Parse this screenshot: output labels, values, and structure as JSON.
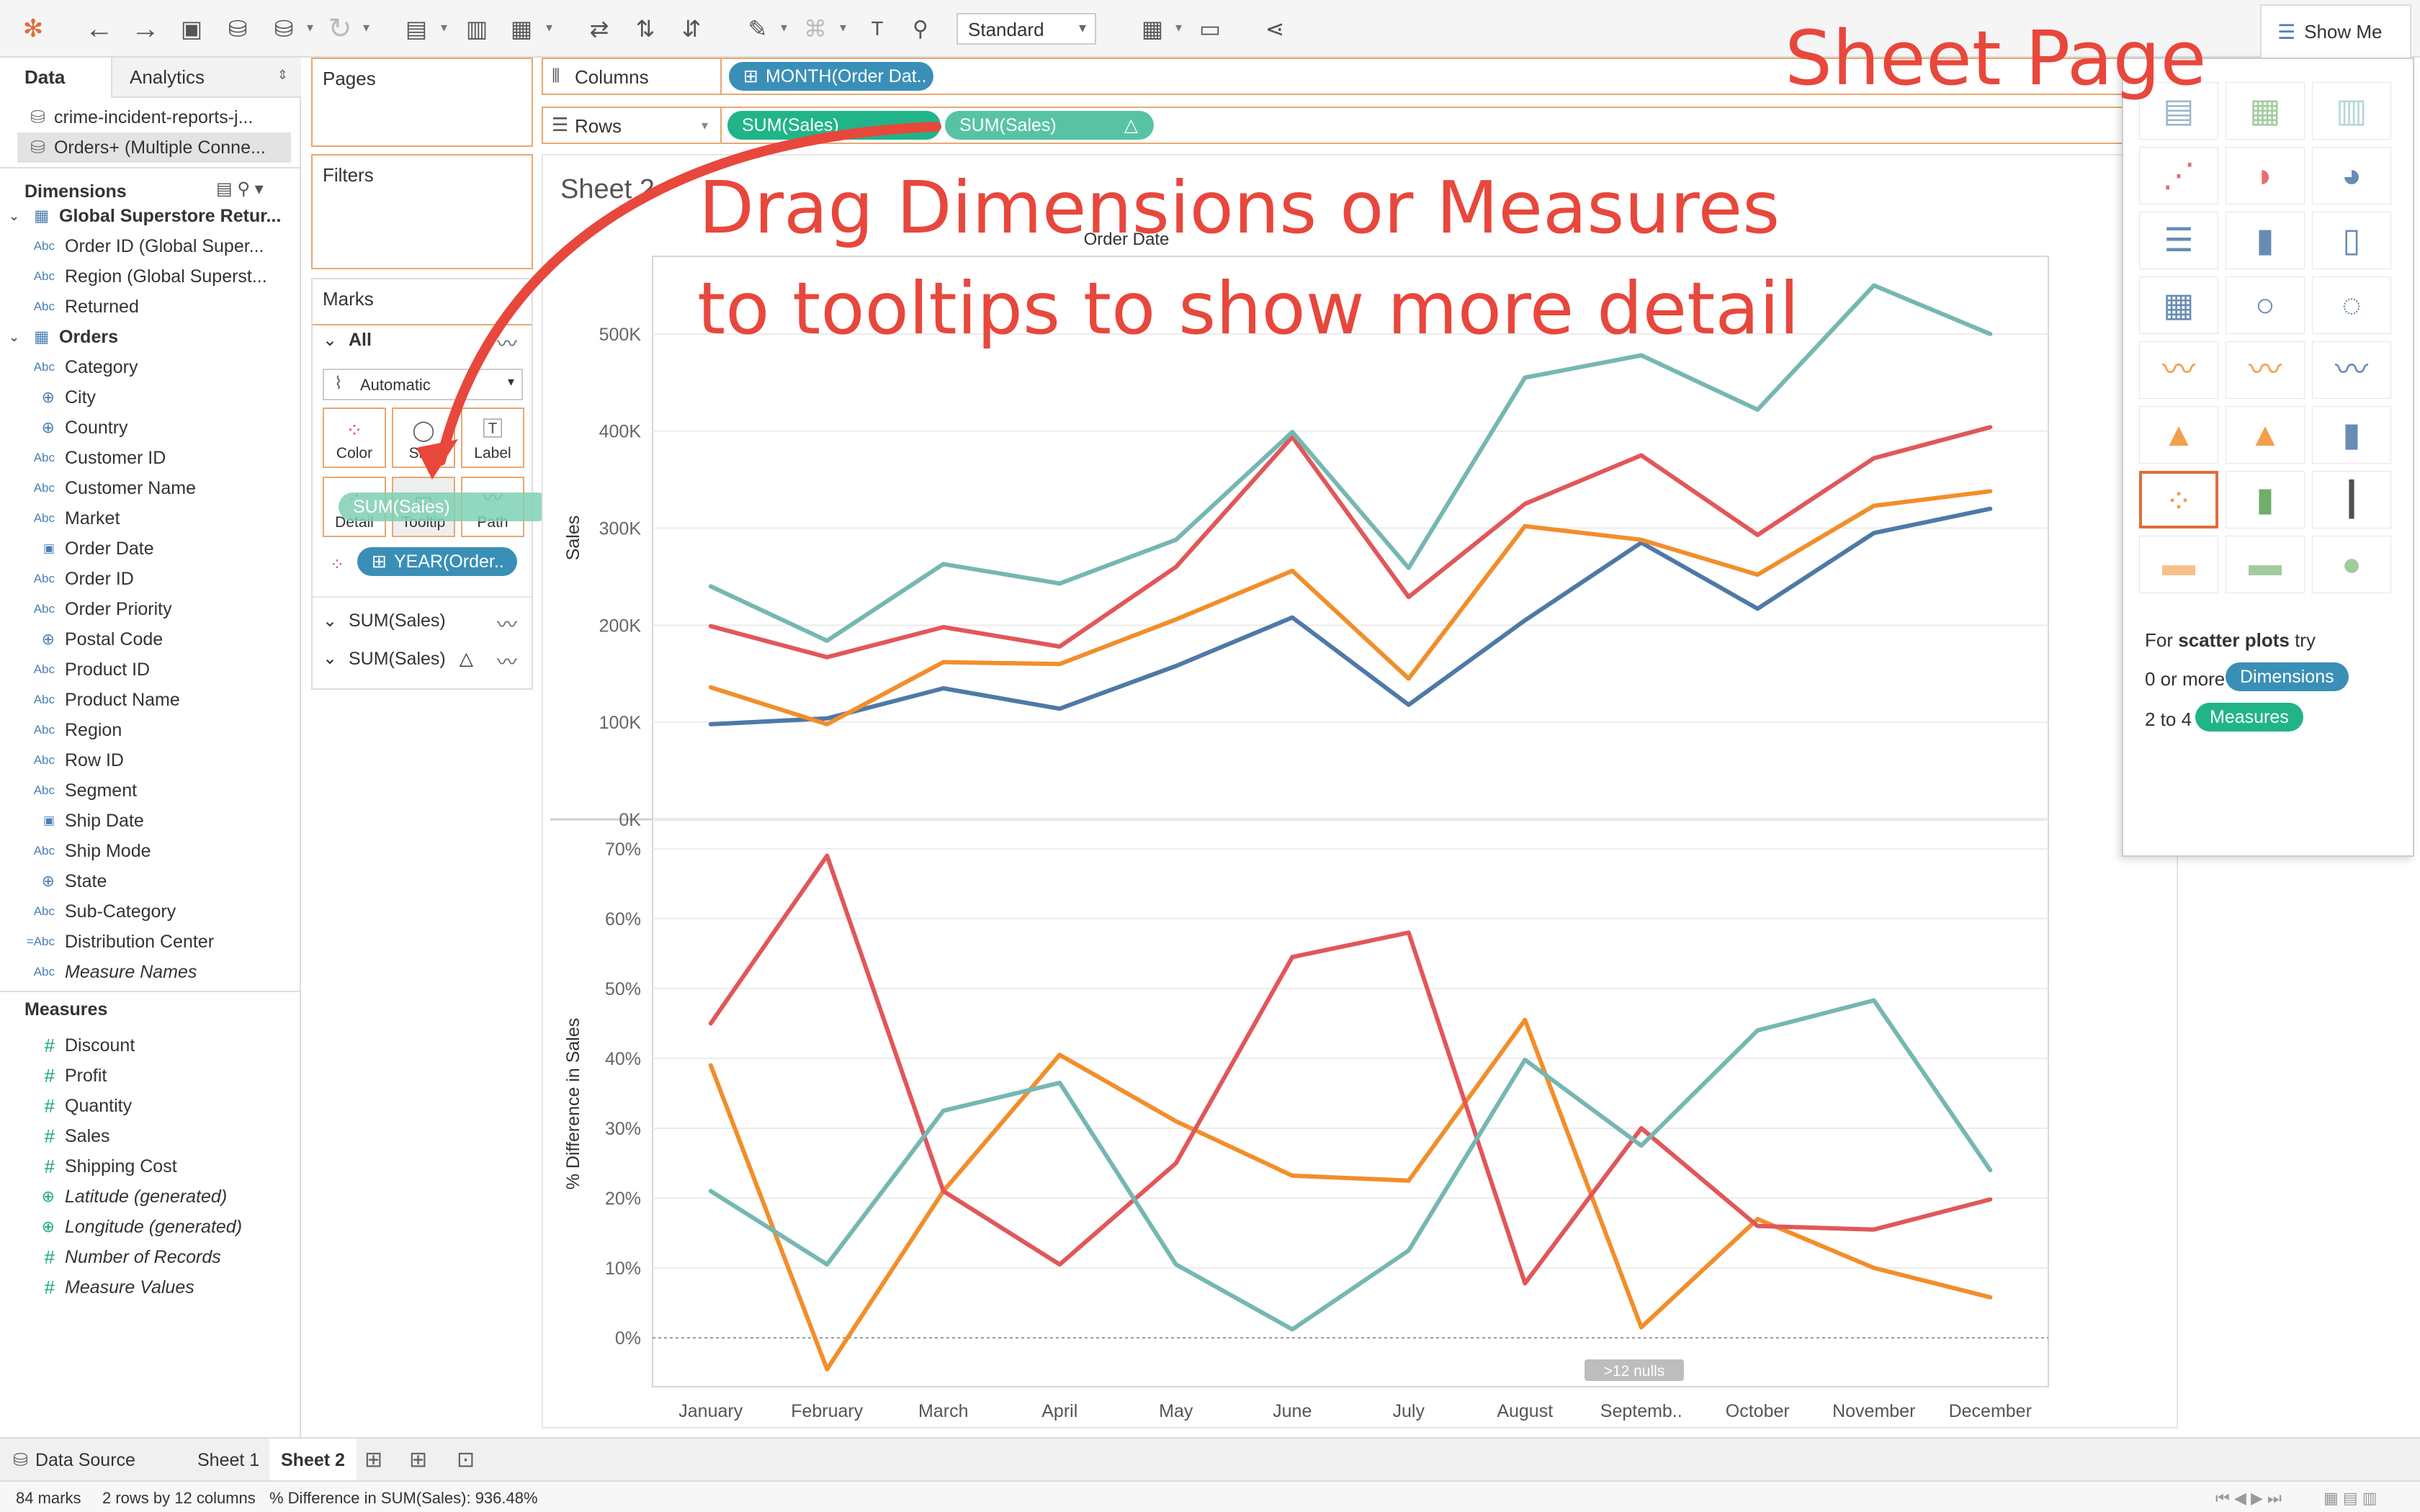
{
  "toolbar": {
    "view_mode": "Standard",
    "show_me_label": "Show Me"
  },
  "left_pane": {
    "tabs": {
      "data": "Data",
      "analytics": "Analytics"
    },
    "data_sources": [
      "crime-incident-reports-j...",
      "Orders+ (Multiple Conne..."
    ],
    "dimensions_title": "Dimensions",
    "dimension_groups": [
      {
        "name": "Global Superstore Retur...",
        "fields": [
          "Order ID (Global Super...",
          "Region (Global Superst...",
          "Returned"
        ]
      },
      {
        "name": "Orders",
        "fields": [
          "Category",
          "City",
          "Country",
          "Customer ID",
          "Customer Name",
          "Market",
          "Order Date",
          "Order ID",
          "Order Priority",
          "Postal Code",
          "Product ID",
          "Product Name",
          "Region",
          "Row ID",
          "Segment",
          "Ship Date",
          "Ship Mode",
          "State",
          "Sub-Category"
        ]
      }
    ],
    "extra_dimensions": [
      "Distribution Center",
      "Measure Names"
    ],
    "measures_title": "Measures",
    "measures": [
      "Discount",
      "Profit",
      "Quantity",
      "Sales",
      "Shipping Cost",
      "Latitude (generated)",
      "Longitude (generated)",
      "Number of Records",
      "Measure Values"
    ]
  },
  "cards": {
    "pages": "Pages",
    "filters": "Filters",
    "marks": "Marks",
    "marks_all": "All",
    "marks_type": "Automatic",
    "buttons": {
      "color": "Color",
      "size": "Size",
      "label": "Label",
      "detail": "Detail",
      "tooltip": "Tooltip",
      "path": "Path"
    },
    "dragged_pill": "SUM(Sales)",
    "year_pill": "YEAR(Order..",
    "marks_sub1": "SUM(Sales)",
    "marks_sub2": "SUM(Sales)"
  },
  "shelves": {
    "columns_label": "Columns",
    "columns_pill": "MONTH(Order Dat..",
    "rows_label": "Rows",
    "rows_pill1": "SUM(Sales)",
    "rows_pill2": "SUM(Sales)"
  },
  "sheet": {
    "title": "Sheet 2",
    "nulls_badge": ">12 nulls"
  },
  "chart_data": [
    {
      "type": "line",
      "title": "Order Date",
      "ylabel": "Sales",
      "categories": [
        "January",
        "February",
        "March",
        "April",
        "May",
        "June",
        "July",
        "August",
        "Septemb..",
        "October",
        "November",
        "December"
      ],
      "ylim": [
        0,
        580000
      ],
      "yticks": [
        "0K",
        "100K",
        "200K",
        "300K",
        "400K",
        "500K"
      ],
      "ytick_values": [
        0,
        100000,
        200000,
        300000,
        400000,
        500000
      ],
      "series": [
        {
          "color": "#4e79a7",
          "values": [
            98000,
            104000,
            135000,
            114000,
            158000,
            208000,
            118000,
            205000,
            285000,
            217000,
            295000,
            320000
          ]
        },
        {
          "color": "#f28e2b",
          "values": [
            136000,
            98000,
            162000,
            160000,
            206000,
            256000,
            145000,
            302000,
            288000,
            252000,
            323000,
            338000
          ]
        },
        {
          "color": "#e15759",
          "values": [
            199000,
            167000,
            198000,
            178000,
            260000,
            394000,
            229000,
            325000,
            375000,
            293000,
            372000,
            404000
          ]
        },
        {
          "color": "#76b7b2",
          "values": [
            240000,
            184000,
            263000,
            243000,
            288000,
            399000,
            259000,
            455000,
            478000,
            422000,
            550000,
            500000
          ]
        }
      ]
    },
    {
      "type": "line",
      "ylabel": "% Difference in Sales",
      "categories": [
        "January",
        "February",
        "March",
        "April",
        "May",
        "June",
        "July",
        "August",
        "Septemb..",
        "October",
        "November",
        "December"
      ],
      "ylim": [
        -0.07,
        0.74
      ],
      "yticks": [
        "0%",
        "10%",
        "20%",
        "30%",
        "40%",
        "50%",
        "60%",
        "70%"
      ],
      "ytick_values": [
        0,
        0.1,
        0.2,
        0.3,
        0.4,
        0.5,
        0.6,
        0.7
      ],
      "series": [
        {
          "color": "#f28e2b",
          "values": [
            0.39,
            -0.045,
            0.21,
            0.405,
            0.31,
            0.232,
            0.225,
            0.455,
            0.015,
            0.17,
            0.1,
            0.058
          ]
        },
        {
          "color": "#e15759",
          "values": [
            0.45,
            0.69,
            0.21,
            0.105,
            0.25,
            0.545,
            0.58,
            0.078,
            0.3,
            0.16,
            0.155,
            0.198
          ]
        },
        {
          "color": "#76b7b2",
          "values": [
            0.21,
            0.105,
            0.325,
            0.365,
            0.105,
            0.012,
            0.125,
            0.398,
            0.275,
            0.44,
            0.483,
            0.24
          ]
        }
      ]
    }
  ],
  "show_me": {
    "hint_prefix": "For",
    "hint_bold": "scatter plots",
    "hint_suffix": "try",
    "dims_prefix": "0 or more",
    "dims_pill": "Dimensions",
    "meas_prefix": "2 to 4",
    "meas_pill": "Measures"
  },
  "bottom_tabs": {
    "data_source": "Data Source",
    "sheet1": "Sheet 1",
    "sheet2": "Sheet 2"
  },
  "status": {
    "marks": "84 marks",
    "rows_cols": "2 rows by 12 columns",
    "diff": "% Difference in SUM(Sales): 936.48%"
  },
  "annotations": {
    "sheet_page": "Sheet Page",
    "line1": "Drag Dimensions or Measures",
    "line2": "to tooltips to show more detail"
  },
  "colors": {
    "accent": "#e8473c",
    "pill_blue": "#3a8fb7",
    "pill_green": "#21b489",
    "shelf_border": "#e8a870"
  }
}
